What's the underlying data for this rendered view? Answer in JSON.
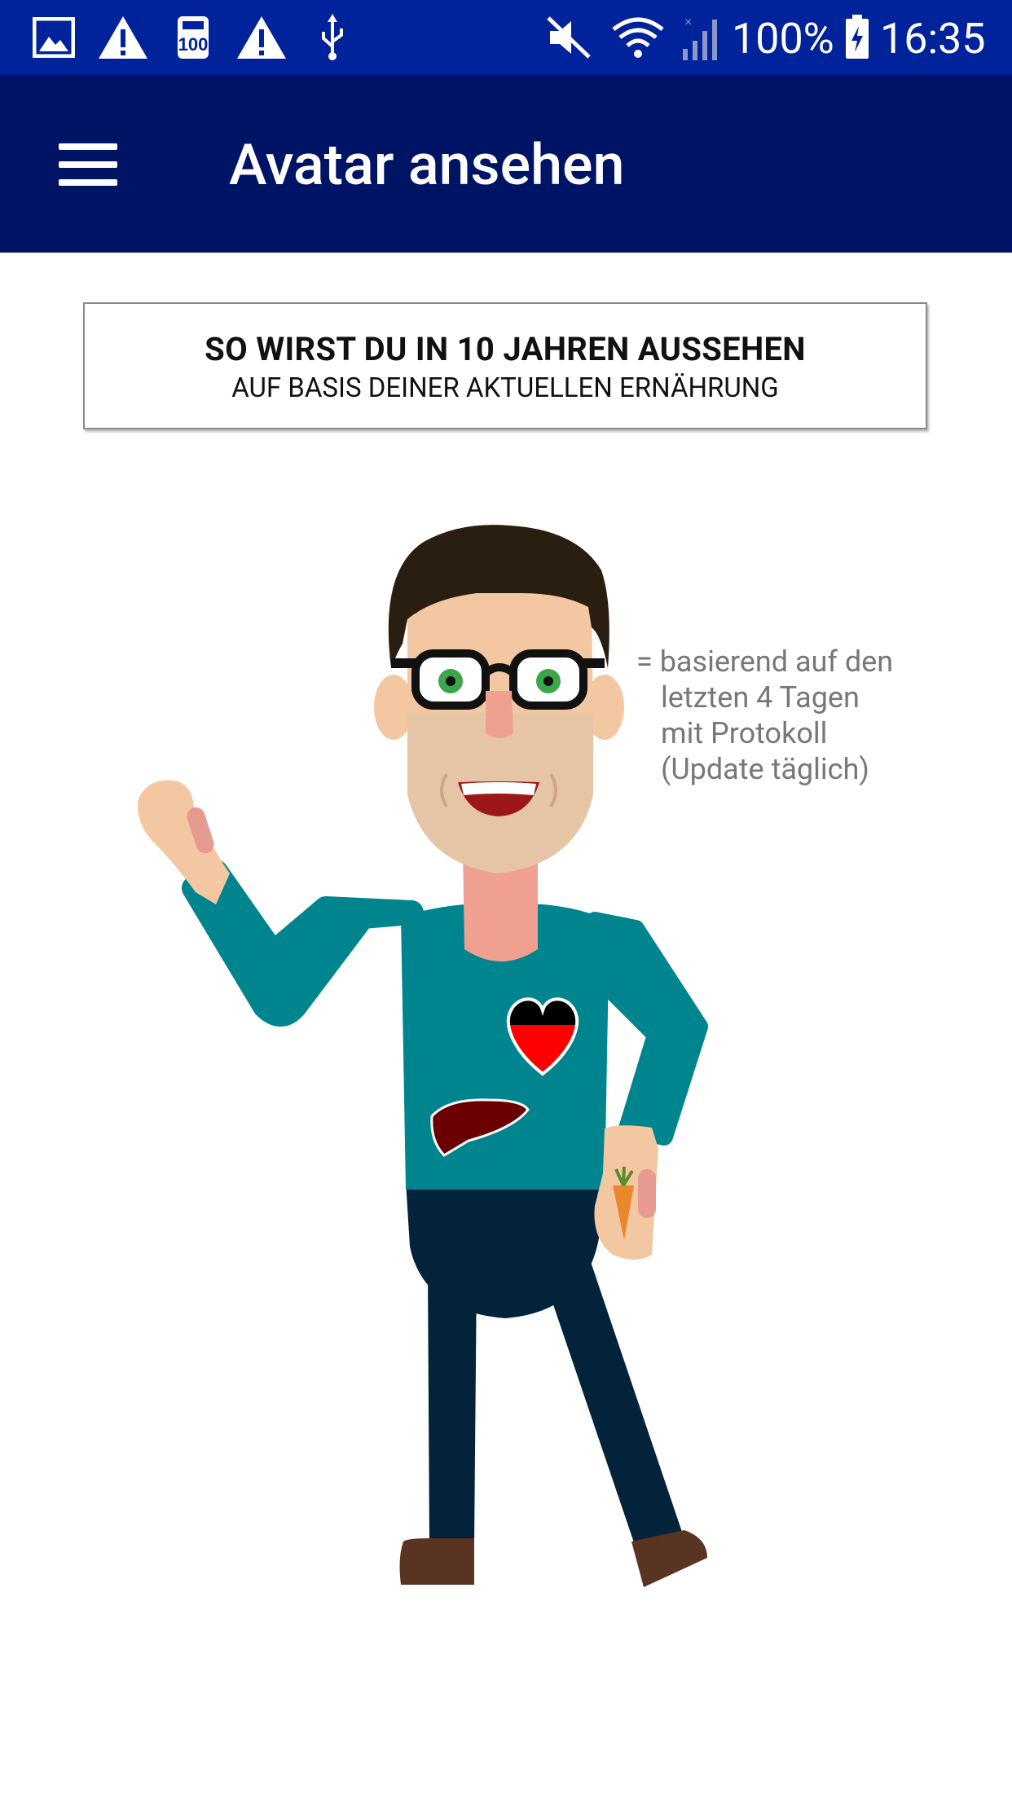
{
  "status_bar": {
    "battery": "100%",
    "time": "16:35",
    "notification_icons": [
      "image-icon",
      "warning-icon",
      "storage-100-icon",
      "warning-icon",
      "usb-icon"
    ],
    "system_icons": [
      "mute-icon",
      "wifi-icon",
      "signal-icon",
      "battery-charging-icon"
    ],
    "background": "#00229a"
  },
  "app_bar": {
    "title": "Avatar ansehen",
    "menu_icon": "hamburger-menu-icon",
    "background": "#001466"
  },
  "banner": {
    "headline": "SO WIRST DU IN 10 JAHREN AUSSEHEN",
    "subline": "AUF BASIS DEINER AKTUELLEN ERNÄHRUNG"
  },
  "note": {
    "lines": [
      "= basierend auf den",
      "letzten 4 Tagen",
      "mit Protokoll",
      "(Update täglich)"
    ]
  },
  "avatar": {
    "shirt_color": "#00858e",
    "pants_color": "#02233a",
    "organs": [
      "heart-icon",
      "liver-icon"
    ],
    "held_item": "carrot-icon"
  }
}
